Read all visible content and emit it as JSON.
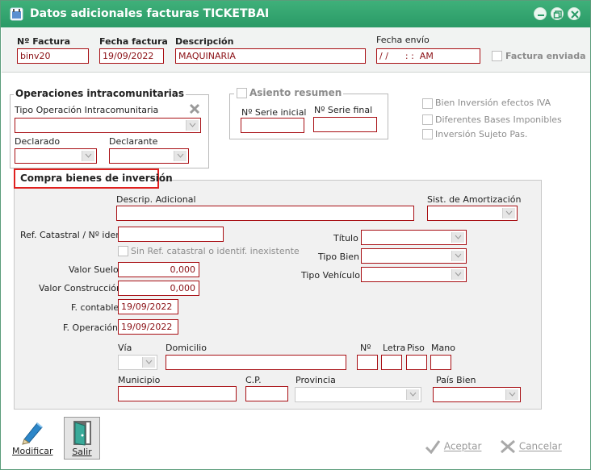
{
  "window": {
    "title": "Datos adicionales facturas TICKETBAI"
  },
  "header": {
    "invoice_label": "Nº Factura",
    "invoice_value": "binv20",
    "date_label": "Fecha factura",
    "date_value": "19/09/2022",
    "desc_label": "Descripción",
    "desc_value": "MAQUINARIA",
    "send_date_label": "Fecha envío",
    "send_date_value": "/ /      : :  AM",
    "sent_label": "Factura enviada"
  },
  "intra": {
    "legend": "Operaciones intracomunitarias",
    "type_label": "Tipo Operación Intracomunitaria",
    "declared_label": "Declarado",
    "declarant_label": "Declarante"
  },
  "asiento": {
    "legend": "Asiento resumen",
    "initial_label": "Nº Serie inicial",
    "final_label": "Nº Serie final"
  },
  "options": {
    "opt1": "Bien Inversión efectos IVA",
    "opt2": "Diferentes Bases Imponibles",
    "opt3": "Inversión Sujeto Pas."
  },
  "compra": {
    "legend": "Compra bienes de inversión",
    "descrip_label": "Descrip. Adicional",
    "amort_label": "Sist. de Amortización",
    "ref_label": "Ref. Catastral / Nº ident.",
    "sin_ref_label": "Sin Ref. catastral o identif. inexistente",
    "titulo_label": "Título",
    "tipo_bien_label": "Tipo Bien",
    "tipo_vehiculo_label": "Tipo Vehículo",
    "valor_suelo_label": "Valor Suelo",
    "valor_suelo": "0,000",
    "valor_const_label": "Valor Construcción",
    "valor_const": "0,000",
    "f_contable_label": "F. contable",
    "f_contable": "19/09/2022",
    "f_operacion_label": "F. Operación",
    "f_operacion": "19/09/2022",
    "via_label": "Vía",
    "domicilio_label": "Domicilio",
    "num_label": "Nº",
    "letra_label": "Letra",
    "piso_label": "Piso",
    "mano_label": "Mano",
    "municipio_label": "Municipio",
    "cp_label": "C.P.",
    "provincia_label": "Provincia",
    "pais_label": "País Bien"
  },
  "toolbar": {
    "modificar": "Modificar",
    "salir": "Salir"
  },
  "actions": {
    "aceptar": "Aceptar",
    "cancelar": "Cancelar"
  },
  "colors": {
    "title_bar": "#2fa56f",
    "field_border": "#a80f14",
    "highlight": "#e0201f"
  }
}
